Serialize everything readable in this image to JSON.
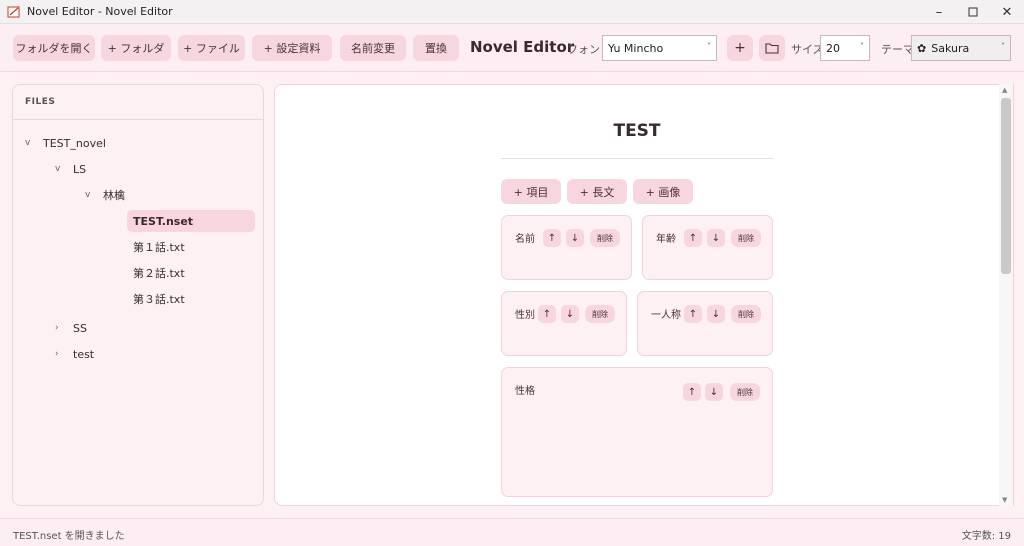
{
  "window": {
    "title": "Novel Editor - Novel Editor"
  },
  "toolbar": {
    "open_folder": "フォルダを開く",
    "new_folder": "+ フォルダ",
    "new_file": "+ ファイル",
    "new_setting": "+ 設定資料",
    "rename": "名前変更",
    "replace": "置換",
    "app_name": "Novel Editor",
    "font_label": "フォント",
    "font_value": "Yu Mincho",
    "plus": "+",
    "size_label": "サイズ",
    "size_value": "20",
    "theme_label": "テーマ",
    "theme_value": "Sakura"
  },
  "sidebar": {
    "header": "FILES",
    "tree": [
      {
        "label": "TEST_novel",
        "expanded": true
      },
      {
        "label": "LS",
        "expanded": true
      },
      {
        "label": "林檎",
        "expanded": true
      },
      {
        "label": "TEST.nset",
        "selected": true
      },
      {
        "label": "第１話.txt"
      },
      {
        "label": "第２話.txt"
      },
      {
        "label": "第３話.txt"
      },
      {
        "label": "SS",
        "expanded": false
      },
      {
        "label": "test",
        "expanded": false
      }
    ],
    "chev_open": "v",
    "chev_closed": "›"
  },
  "editor": {
    "title": "TEST",
    "add_item": "+ 項目",
    "add_long": "+ 長文",
    "add_image": "+ 画像",
    "up": "↑",
    "down": "↓",
    "delete": "削除",
    "cards": [
      {
        "label": "名前"
      },
      {
        "label": "年齢"
      },
      {
        "label": "性別"
      },
      {
        "label": "一人称"
      },
      {
        "label": "性格"
      }
    ]
  },
  "status": {
    "message": "TEST.nset を開きました",
    "char_count": "文字数: 19"
  },
  "colors": {
    "accent": "#f7d6df",
    "background": "#fdf1f4"
  }
}
